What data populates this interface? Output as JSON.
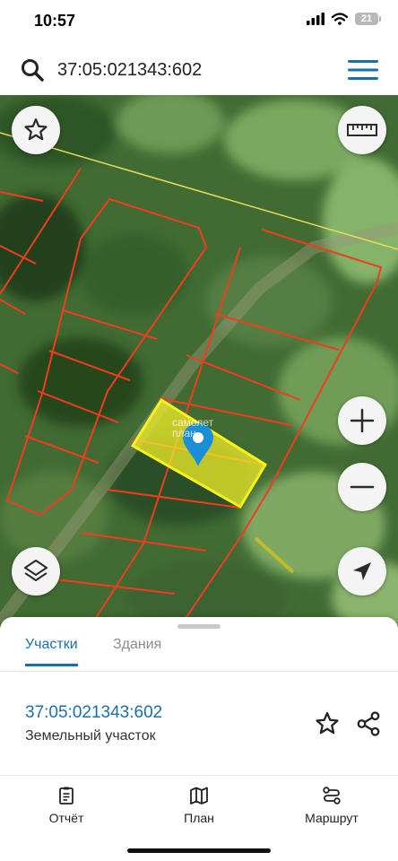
{
  "status": {
    "time": "10:57",
    "battery": "21"
  },
  "search": {
    "value": "37:05:021343:602"
  },
  "map": {
    "watermark_line1": "самолет",
    "watermark_line2": "план"
  },
  "tabs": [
    {
      "label": "Участки",
      "active": true
    },
    {
      "label": "Здания",
      "active": false
    }
  ],
  "parcel": {
    "number": "37:05:021343:602",
    "type": "Земельный участок"
  },
  "nav": [
    {
      "label": "Отчёт",
      "icon": "report-icon"
    },
    {
      "label": "План",
      "icon": "map-icon"
    },
    {
      "label": "Маршрут",
      "icon": "route-icon"
    }
  ],
  "colors": {
    "accent": "#1b6fa8",
    "parcel_border": "#f23c1f",
    "selected_fill": "#f2ee2a",
    "marker": "#1a8fd8"
  }
}
